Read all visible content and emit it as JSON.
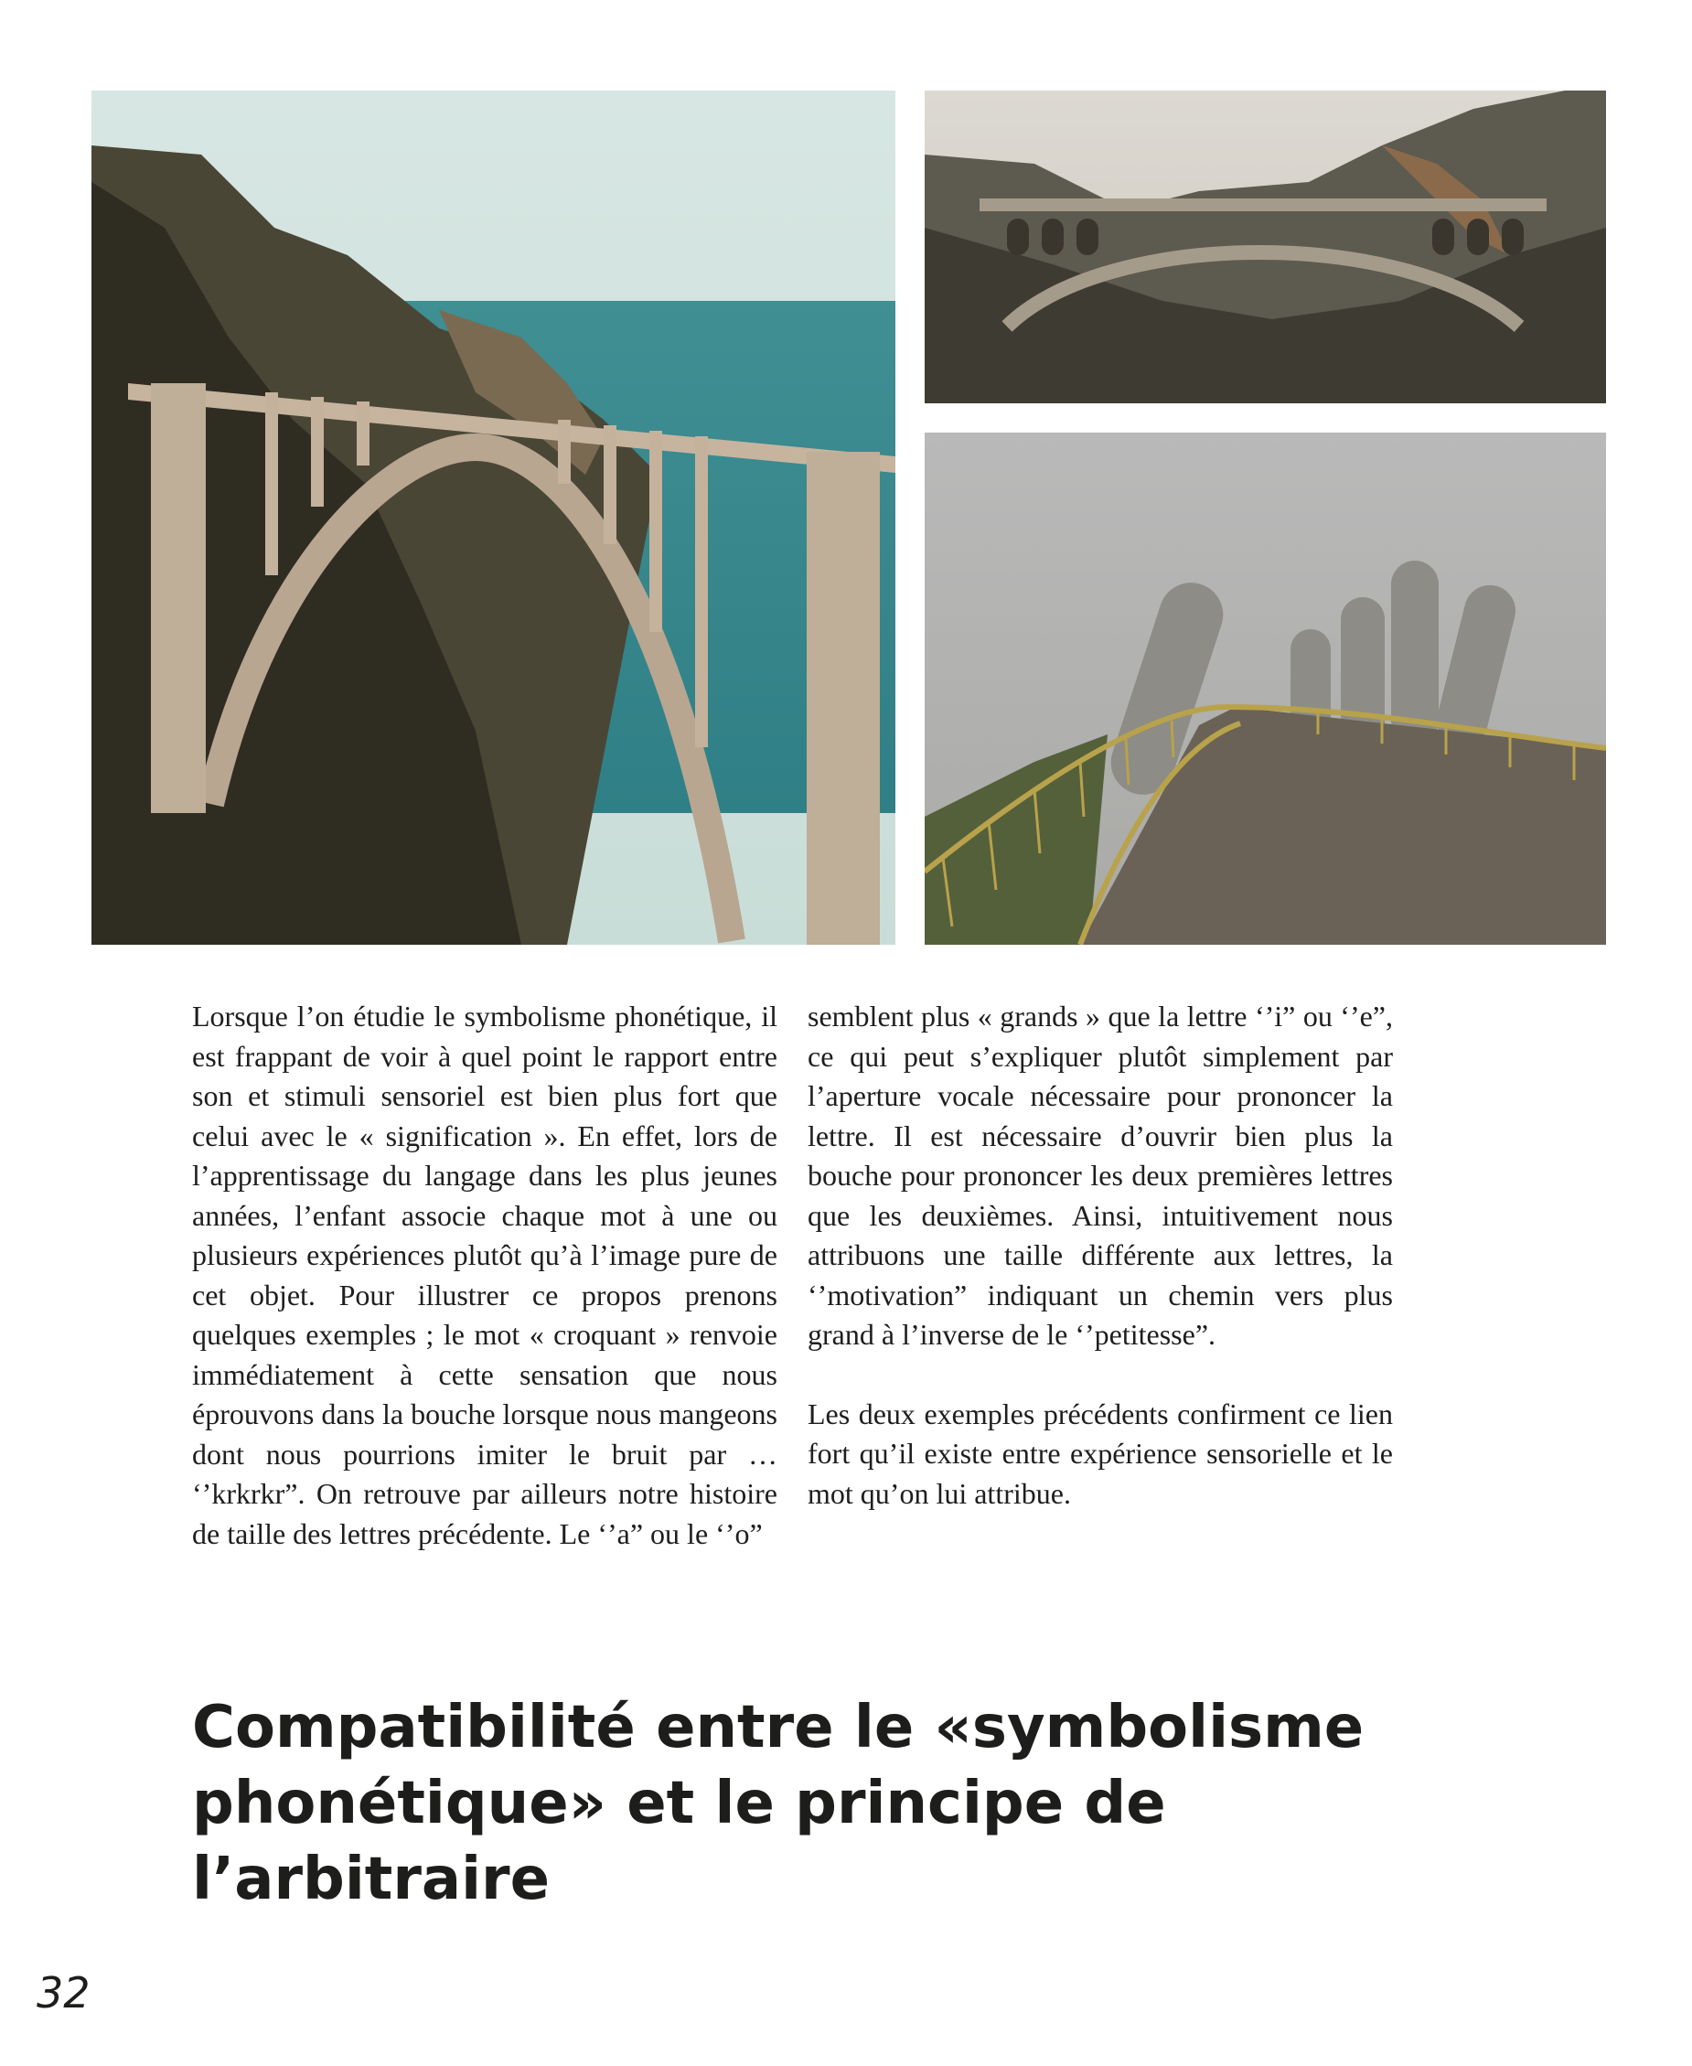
{
  "images": {
    "left": {
      "subject": "arched concrete bridge over a coastal canyon with the sea behind"
    },
    "top_right": {
      "subject": "stone arch bridge spanning a rocky gorge"
    },
    "bottom_right": {
      "subject": "golden walkway bridge held up by giant stone hands in fog"
    }
  },
  "body": {
    "left_column": "Lorsque l’on étudie le symbolisme phonétique, il est frappant de voir à quel point le rapport entre son et stimuli sensoriel est bien plus fort que celui avec le « signification ». En effet, lors de l’apprentissage du langage dans les plus jeunes années, l’enfant associe chaque mot à une ou plusieurs expériences plutôt qu’à l’image pure de cet objet. Pour illustrer ce propos prenons quelques exemples ; le mot « croquant » renvoie immédiatement à cette sensation que nous éprouvons dans la bouche lorsque nous mangeons dont nous pourrions imiter le bruit par … ‘’krkrkr”. On retrouve par ailleurs notre histoire de taille des lettres précédente. Le ‘’a” ou le ‘’o”",
    "right_column_p1": "semblent plus « grands » que la lettre ‘’i” ou ‘’e”, ce qui peut s’expliquer plutôt simplement par l’aperture vocale nécessaire pour prononcer la lettre. Il est nécessaire d’ouvrir bien plus la bouche pour prononcer les deux premières lettres que les deuxièmes. Ainsi, intuitivement nous attribuons une taille différente aux lettres, la ‘’motivation” indiquant un chemin vers plus grand à l’inverse de le ‘’petitesse”.",
    "right_column_p2": "Les deux exemples précédents confirment ce lien fort qu’il existe entre expérience sensorielle et le mot qu’on lui attribue."
  },
  "heading": "Compatibilité entre le «symbolisme phonétique» et le principe de l’arbitraire",
  "page_number": "32"
}
